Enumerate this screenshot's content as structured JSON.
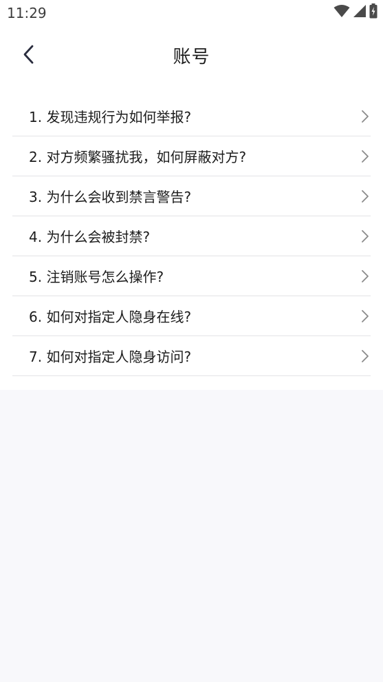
{
  "status_bar": {
    "time": "11:29",
    "icons": [
      "wifi-icon",
      "cellular-signal-icon",
      "battery-charging-icon"
    ]
  },
  "header": {
    "title": "账号",
    "back_icon": "chevron-left-icon"
  },
  "faq": {
    "items": [
      {
        "label": "1. 发现违规行为如何举报?"
      },
      {
        "label": "2. 对方频繁骚扰我，如何屏蔽对方?"
      },
      {
        "label": "3. 为什么会收到禁言警告?"
      },
      {
        "label": "4. 为什么会被封禁?"
      },
      {
        "label": "5. 注销账号怎么操作?"
      },
      {
        "label": "6. 如何对指定人隐身在线?"
      },
      {
        "label": "7. 如何对指定人隐身访问?"
      }
    ],
    "item_icon": "chevron-right-icon"
  },
  "colors": {
    "background": "#ffffff",
    "lower_background": "#f8f8fb",
    "divider": "#e3e3e6",
    "text": "#1c1c1c",
    "chevron": "#8a8a8a"
  }
}
